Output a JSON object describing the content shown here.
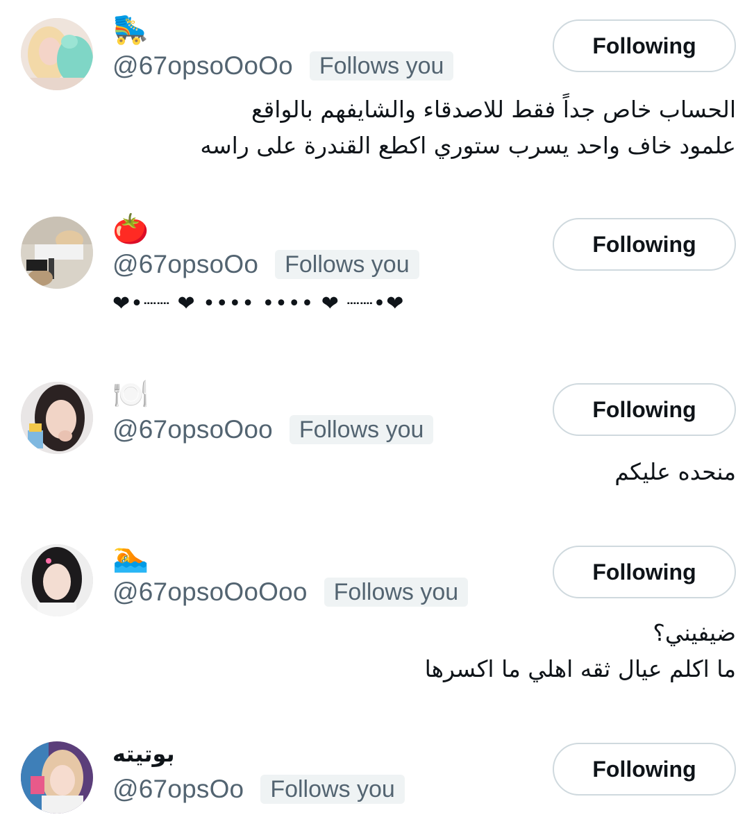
{
  "users": [
    {
      "name": "🛼",
      "handle": "@67opsoOoOo",
      "follows_you": "Follows you",
      "button": "Following",
      "bio": "الحساب خاص جداً فقط للاصدقاء والشايفهم بالواقع\nعلمود خاف واحد يسرب ستوري اكطع القندرة على راسه"
    },
    {
      "name": "🍅",
      "handle": "@67opsoOo",
      "follows_you": "Follows you",
      "button": "Following",
      "bio": "❤︎•┈┈ ❤︎ •••• •••• ❤︎ ┈┈•❤︎"
    },
    {
      "name": "🍽️",
      "handle": "@67opsoOoo",
      "follows_you": "Follows you",
      "button": "Following",
      "bio": "منحده عليكم"
    },
    {
      "name": "🏊",
      "handle": "@67opsoOoOoo",
      "follows_you": "Follows you",
      "button": "Following",
      "bio": "ضيفيني؟\nما اكلم عيال ثقه اهلي ما اكسرها"
    },
    {
      "name": "بوتيته",
      "handle": "@67opsOo",
      "follows_you": "Follows you",
      "button": "Following",
      "bio": ""
    }
  ]
}
